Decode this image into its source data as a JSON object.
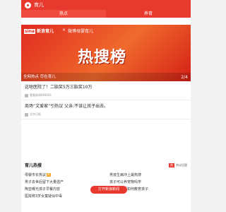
{
  "header": {
    "title": "育儿"
  },
  "tabs": [
    {
      "label": "热点"
    },
    {
      "label": "养育"
    }
  ],
  "banner": {
    "brand_prefix": "sina",
    "brand_suffix": "新浪育儿",
    "separator": "×",
    "partner": "微博母婴育儿",
    "headline": "热搜榜",
    "caption": "全网热点 尽在育儿",
    "pager": "2/4"
  },
  "news": [
    {
      "title": "这啥医院了！二胎奖5万三胎奖10万",
      "source": "看看新闻KNEWS"
    },
    {
      "title": "商场“文爱家”引热议 父亲:不该让孩子出去。",
      "source": "北京日报"
    }
  ],
  "hot": {
    "title": "育儿热搜",
    "badge": "热",
    "more": "热议话题",
    "items": [
      {
        "text": "母婴市长热议",
        "tag": "热"
      },
      {
        "text": "男孩生病冲上最热搜",
        "tag": ""
      },
      {
        "text": "男子去世后留下大量遗产",
        "tag": ""
      },
      {
        "text": "孩子可以养宠物吗学",
        "tag": ""
      },
      {
        "text": "陶亚曝光孩子早餐内容",
        "tag": ""
      },
      {
        "text": "妈妈到底要如何教育孩子",
        "tag": ""
      },
      {
        "text": "医院称3岁女童疑似中毒",
        "tag": ""
      },
      {
        "text": "",
        "tag": ""
      }
    ],
    "overlay_button": "打开新浪新闻"
  }
}
